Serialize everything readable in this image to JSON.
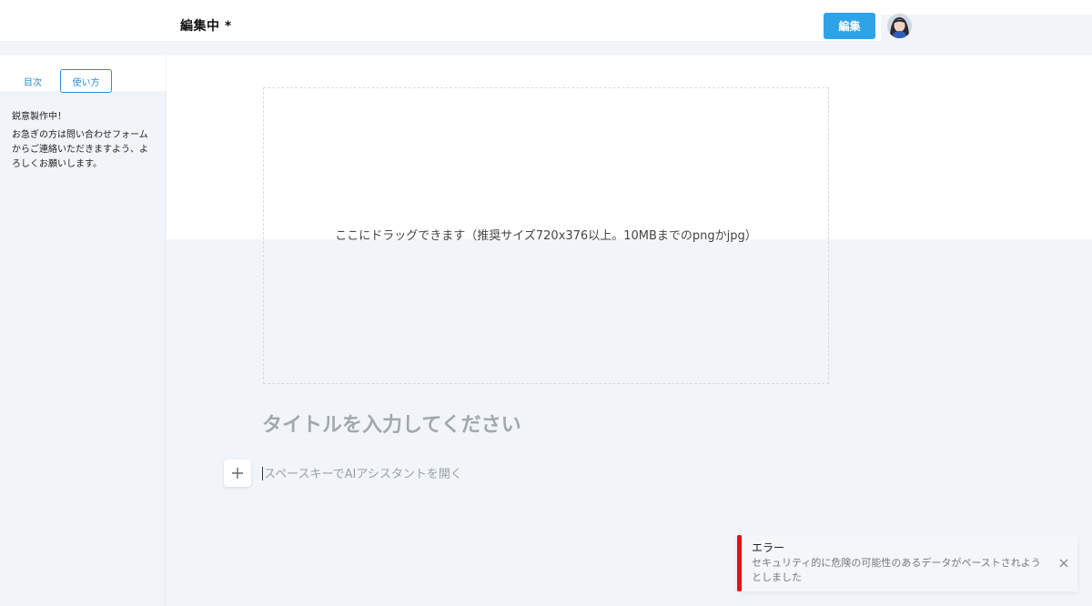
{
  "header": {
    "title": "編集中 *",
    "edit_label": "編集"
  },
  "sidebar": {
    "tabs": [
      {
        "label": "目次"
      },
      {
        "label": "使い方"
      }
    ],
    "heading": "鋭意製作中！",
    "text": "お急ぎの方は問い合わせフォームからご連絡いただきますよう、よろしくお願いします。"
  },
  "editor": {
    "dropzone_text": "ここにドラッグできます（推奨サイズ720x376以上。10MBまでのpngかjpg）",
    "title_placeholder": "タイトルを入力してください",
    "body_placeholder": "スペースキーでAIアシスタントを開く"
  },
  "toast": {
    "title": "エラー",
    "message": "セキュリティ的に危険の可能性のあるデータがペーストされようとしました"
  },
  "colors": {
    "accent": "#2fa3e8",
    "error": "#e0121b"
  },
  "icons": {
    "add": "plus-icon",
    "close": "close-icon"
  }
}
